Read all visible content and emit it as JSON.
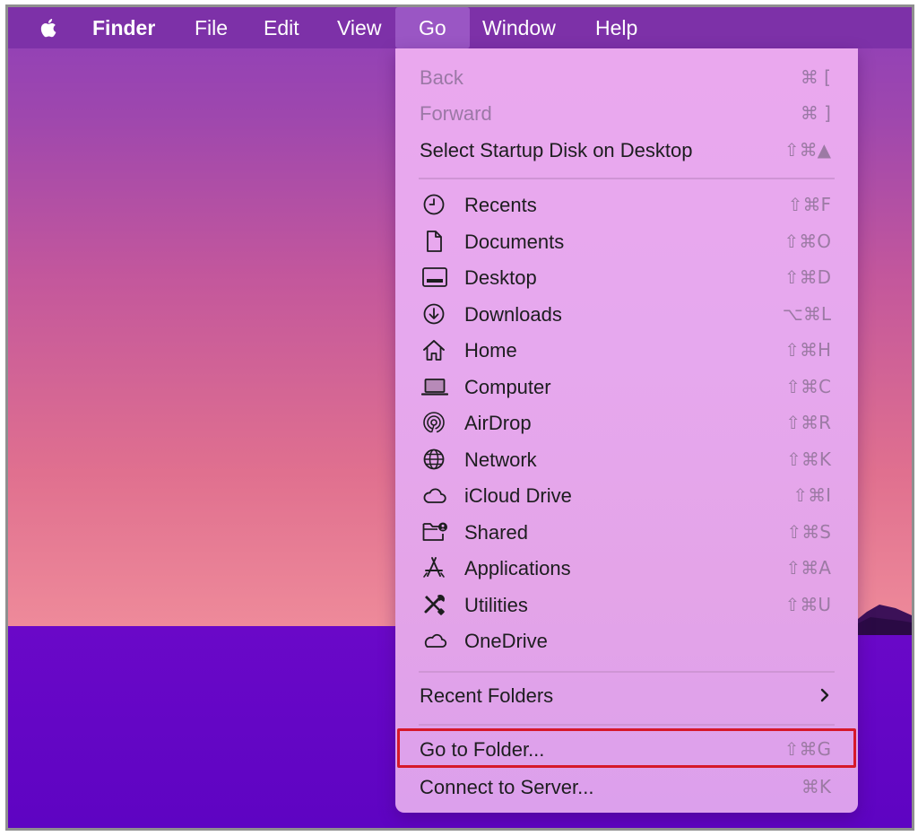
{
  "menubar": {
    "app_name": "Finder",
    "items": [
      "File",
      "Edit",
      "View",
      "Go",
      "Window",
      "Help"
    ],
    "active": "Go"
  },
  "go_menu": {
    "nav": [
      {
        "label": "Back",
        "shortcut": "⌘ [",
        "enabled": false
      },
      {
        "label": "Forward",
        "shortcut": "⌘ ]",
        "enabled": false
      },
      {
        "label": "Select Startup Disk on Desktop",
        "shortcut": "⇧⌘▲",
        "enabled": true
      }
    ],
    "places": [
      {
        "label": "Recents",
        "shortcut": "⇧⌘F",
        "icon": "clock-icon"
      },
      {
        "label": "Documents",
        "shortcut": "⇧⌘O",
        "icon": "document-icon"
      },
      {
        "label": "Desktop",
        "shortcut": "⇧⌘D",
        "icon": "desktop-icon"
      },
      {
        "label": "Downloads",
        "shortcut": "⌥⌘L",
        "icon": "download-icon"
      },
      {
        "label": "Home",
        "shortcut": "⇧⌘H",
        "icon": "home-icon"
      },
      {
        "label": "Computer",
        "shortcut": "⇧⌘C",
        "icon": "laptop-icon"
      },
      {
        "label": "AirDrop",
        "shortcut": "⇧⌘R",
        "icon": "airdrop-icon"
      },
      {
        "label": "Network",
        "shortcut": "⇧⌘K",
        "icon": "globe-icon"
      },
      {
        "label": "iCloud Drive",
        "shortcut": "⇧⌘I",
        "icon": "cloud-icon"
      },
      {
        "label": "Shared",
        "shortcut": "⇧⌘S",
        "icon": "shared-folder-icon"
      },
      {
        "label": "Applications",
        "shortcut": "⇧⌘A",
        "icon": "applications-icon"
      },
      {
        "label": "Utilities",
        "shortcut": "⇧⌘U",
        "icon": "utilities-icon"
      },
      {
        "label": "OneDrive",
        "shortcut": "",
        "icon": "cloud-icon"
      }
    ],
    "recent_folders": {
      "label": "Recent Folders"
    },
    "go_to_folder": {
      "label": "Go to Folder...",
      "shortcut": "⇧⌘G"
    },
    "connect_to_server": {
      "label": "Connect to Server...",
      "shortcut": "⌘K"
    }
  },
  "colors": {
    "highlight_border": "#d6182a",
    "menubar": "#7d31a8",
    "menu_background": "#e6a8ee"
  }
}
